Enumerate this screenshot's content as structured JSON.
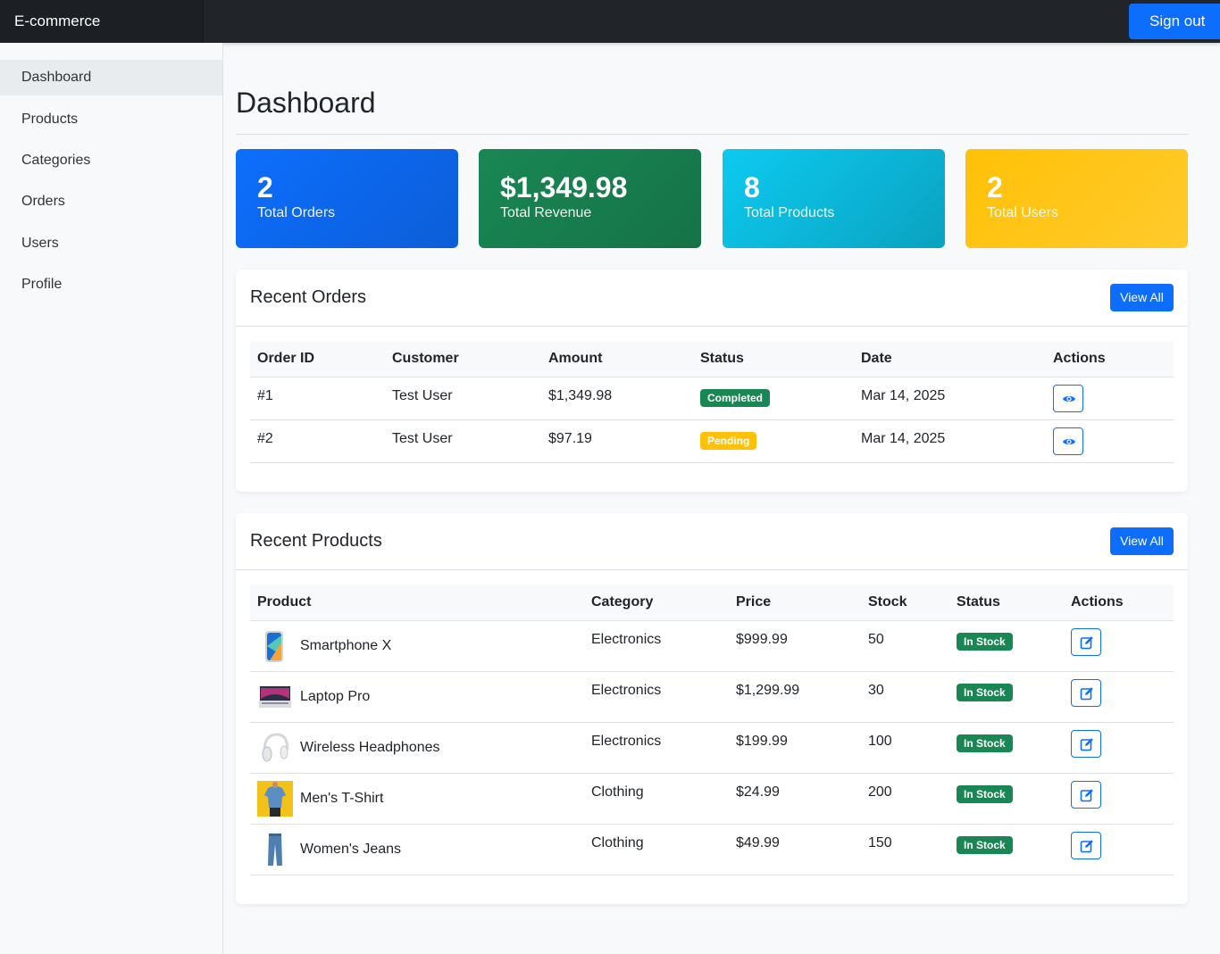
{
  "app": {
    "brand": "E-commerce",
    "signout_label": "Sign out"
  },
  "sidebar": {
    "items": [
      {
        "label": "Dashboard",
        "active": true
      },
      {
        "label": "Products"
      },
      {
        "label": "Categories"
      },
      {
        "label": "Orders"
      },
      {
        "label": "Users"
      },
      {
        "label": "Profile"
      }
    ]
  },
  "page": {
    "title": "Dashboard"
  },
  "stats": [
    {
      "value": "2",
      "label": "Total Orders",
      "color": "#0d6efd"
    },
    {
      "value": "$1,349.98",
      "label": "Total Revenue",
      "color": "#198754"
    },
    {
      "value": "8",
      "label": "Total Products",
      "color": "#0dcaf0"
    },
    {
      "value": "2",
      "label": "Total Users",
      "color": "#ffc107"
    }
  ],
  "recent_orders": {
    "title": "Recent Orders",
    "view_all": "View All",
    "columns": [
      "Order ID",
      "Customer",
      "Amount",
      "Status",
      "Date",
      "Actions"
    ],
    "rows": [
      {
        "id": "#1",
        "customer": "Test User",
        "amount": "$1,349.98",
        "status": "Completed",
        "date": "Mar 14, 2025"
      },
      {
        "id": "#2",
        "customer": "Test User",
        "amount": "$97.19",
        "status": "Pending",
        "date": "Mar 14, 2025"
      }
    ]
  },
  "recent_products": {
    "title": "Recent Products",
    "view_all": "View All",
    "columns": [
      "Product",
      "Category",
      "Price",
      "Stock",
      "Status",
      "Actions"
    ],
    "rows": [
      {
        "name": "Smartphone X",
        "category": "Electronics",
        "price": "$999.99",
        "stock": "50",
        "status": "In Stock"
      },
      {
        "name": "Laptop Pro",
        "category": "Electronics",
        "price": "$1,299.99",
        "stock": "30",
        "status": "In Stock"
      },
      {
        "name": "Wireless Headphones",
        "category": "Electronics",
        "price": "$199.99",
        "stock": "100",
        "status": "In Stock"
      },
      {
        "name": "Men's T-Shirt",
        "category": "Clothing",
        "price": "$24.99",
        "stock": "200",
        "status": "In Stock"
      },
      {
        "name": "Women's Jeans",
        "category": "Clothing",
        "price": "$49.99",
        "stock": "150",
        "status": "In Stock"
      }
    ]
  },
  "colors": {
    "primary": "#0d6efd",
    "success": "#198754",
    "warning": "#ffc107",
    "info": "#0dcaf0",
    "dark": "#212529"
  }
}
